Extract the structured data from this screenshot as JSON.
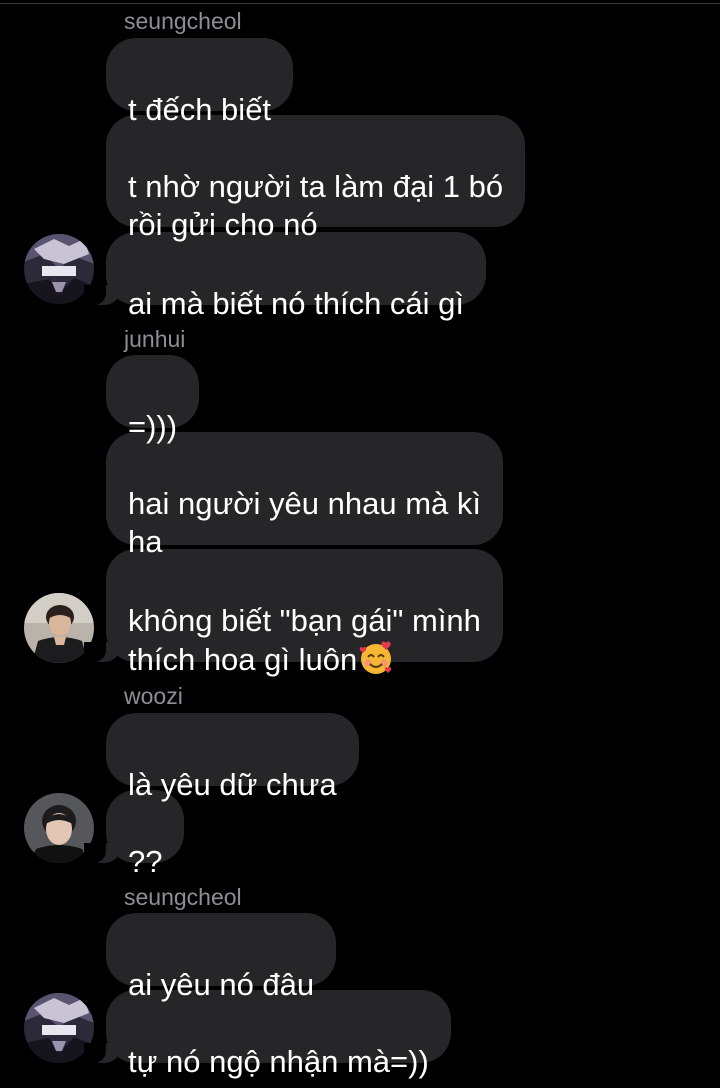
{
  "thread": {
    "groups": [
      {
        "sender": "seungcheol",
        "avatar_icon": "anime-dark-avatar-icon",
        "messages": [
          "t đếch biết",
          "t nhờ người ta làm đại 1 bó\nrồi gửi cho nó",
          "ai mà biết nó thích cái gì"
        ]
      },
      {
        "sender": "junhui",
        "avatar_icon": "photo-man-avatar-icon",
        "messages": [
          "=)))",
          "hai người yêu nhau mà kì\nha",
          "không biết \"bạn gái\" mình\nthích hoa gì luôn"
        ],
        "emoji": "smiling-face-with-hearts-icon"
      },
      {
        "sender": "woozi",
        "avatar_icon": "photo-portrait-avatar-icon",
        "messages": [
          "là yêu dữ chưa",
          "??"
        ]
      },
      {
        "sender": "seungcheol",
        "avatar_icon": "anime-dark-avatar-icon",
        "messages": [
          "ai yêu nó đâu",
          "tự nó ngộ nhận mà=))"
        ]
      }
    ]
  },
  "colors": {
    "background": "#000000",
    "bubble": "#262628",
    "sender_text": "#8e8e93",
    "message_text": "#ffffff"
  }
}
